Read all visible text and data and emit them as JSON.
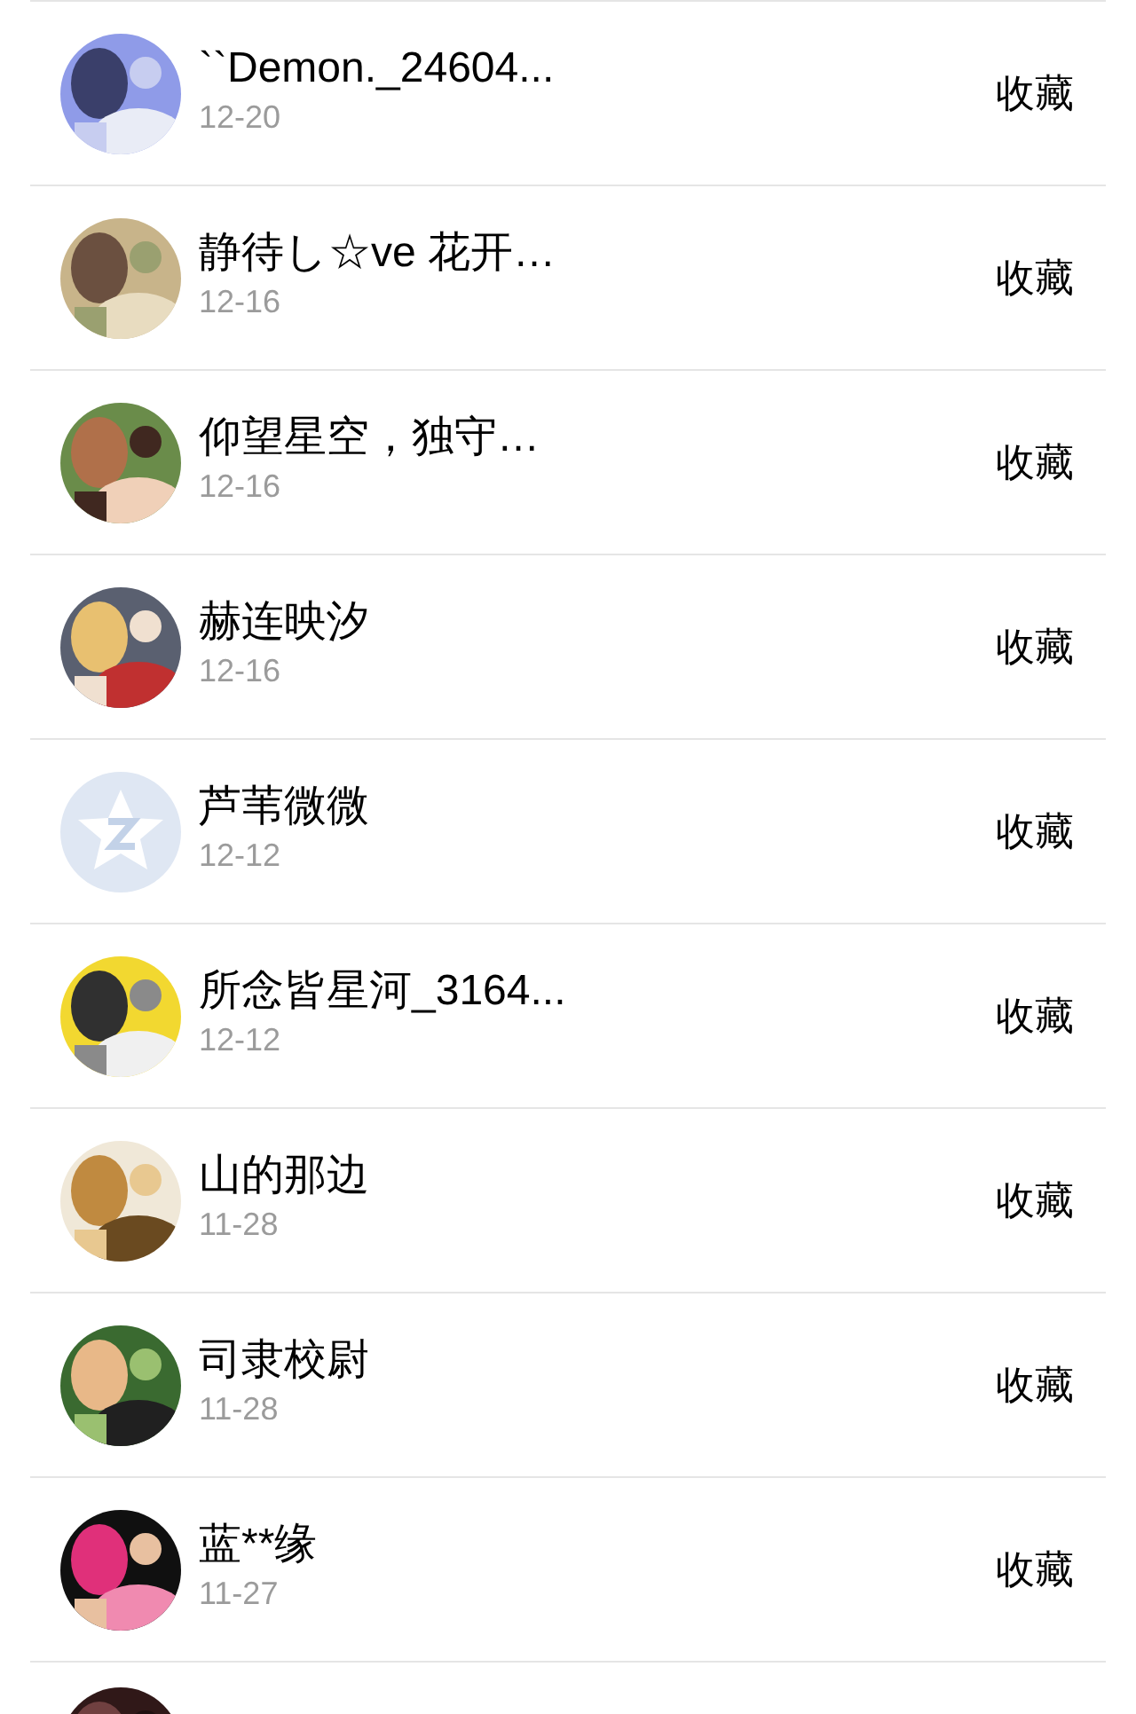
{
  "rows": [
    {
      "avatar": {
        "kind": "picture"
      },
      "name": "``Demon._24604...",
      "date": "12-20",
      "action": "收藏"
    },
    {
      "avatar": {
        "kind": "picture"
      },
      "name": "静待し☆ve 花开…",
      "date": "12-16",
      "action": "收藏"
    },
    {
      "avatar": {
        "kind": "picture"
      },
      "name": "仰望星空，独守…",
      "date": "12-16",
      "action": "收藏"
    },
    {
      "avatar": {
        "kind": "picture"
      },
      "name": "赫连映汐",
      "date": "12-16",
      "action": "收藏"
    },
    {
      "avatar": {
        "kind": "default"
      },
      "name": "芦苇微微",
      "date": "12-12",
      "action": "收藏"
    },
    {
      "avatar": {
        "kind": "picture"
      },
      "name": "所念皆星河_3164...",
      "date": "12-12",
      "action": "收藏"
    },
    {
      "avatar": {
        "kind": "picture"
      },
      "name": "山的那边",
      "date": "11-28",
      "action": "收藏"
    },
    {
      "avatar": {
        "kind": "picture"
      },
      "name": "司隶校尉",
      "date": "11-28",
      "action": "收藏"
    },
    {
      "avatar": {
        "kind": "picture"
      },
      "name": "蓝**缘",
      "date": "11-27",
      "action": "收藏"
    },
    {
      "avatar": {
        "kind": "picture"
      }
    }
  ]
}
